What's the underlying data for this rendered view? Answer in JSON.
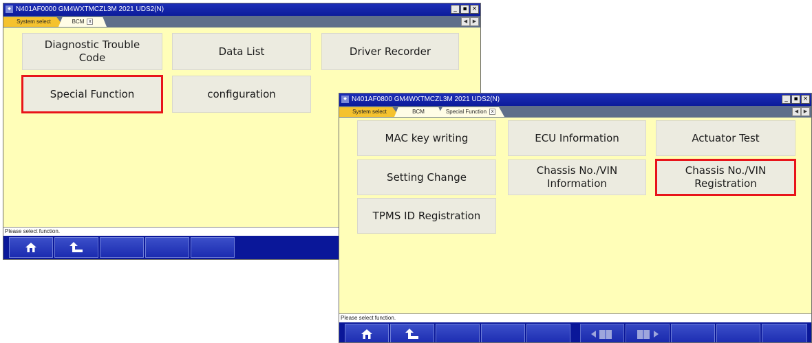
{
  "window1": {
    "title": "N401AF0000  GM4WXTMCZL3M 2021  UDS2(N)",
    "tabs": [
      {
        "label": "System select"
      },
      {
        "label": "BCM"
      }
    ],
    "buttons": [
      {
        "label": "Diagnostic Trouble Code"
      },
      {
        "label": "Data List"
      },
      {
        "label": "Driver Recorder"
      },
      {
        "label": "Special Function"
      },
      {
        "label": "configuration"
      }
    ],
    "status": "Please select function."
  },
  "window2": {
    "title": "N401AF0800  GM4WXTMCZL3M 2021  UDS2(N)",
    "tabs": [
      {
        "label": "System select"
      },
      {
        "label": "BCM"
      },
      {
        "label": "Special Function"
      }
    ],
    "buttons": [
      {
        "label": "MAC key writing"
      },
      {
        "label": "ECU Information"
      },
      {
        "label": "Actuator Test"
      },
      {
        "label": "Setting Change"
      },
      {
        "label": "Chassis No./VIN Information"
      },
      {
        "label": "Chassis No./VIN Registration"
      },
      {
        "label": "TPMS ID Registration"
      }
    ],
    "status": "Please select function."
  },
  "icons": {
    "app": "app-icon",
    "home": "home-icon",
    "back": "back-arrow-icon",
    "prev_page": "prev-page-icon",
    "next_page": "next-page-icon"
  },
  "colors": {
    "content_bg": "#fffeb8",
    "titlebar": "#0c1b9a",
    "highlight": "#e8141a",
    "button_bg": "#ecebe0",
    "active_tab": "#f5c22e"
  }
}
